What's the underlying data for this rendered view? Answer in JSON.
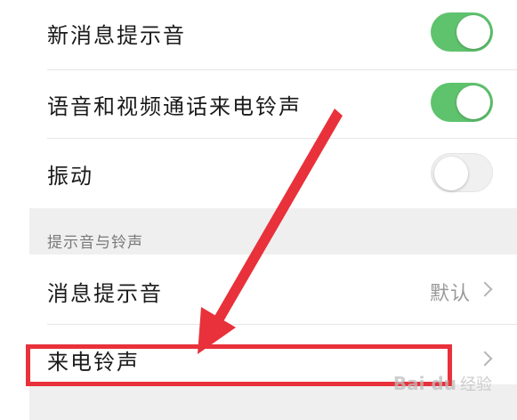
{
  "settings": {
    "rows": [
      {
        "label": "新消息提示音",
        "toggle": "on"
      },
      {
        "label": "语音和视频通话来电铃声",
        "toggle": "on"
      },
      {
        "label": "振动",
        "toggle": "off"
      }
    ],
    "section_title": "提示音与铃声",
    "message_tone": {
      "label": "消息提示音",
      "value": "默认"
    },
    "ringtone": {
      "label": "来电铃声"
    }
  },
  "colors": {
    "toggle_on": "#5fc36e",
    "annotation_red": "#e8313b"
  },
  "watermark": {
    "brand": "Bai du",
    "sub": "经验"
  }
}
